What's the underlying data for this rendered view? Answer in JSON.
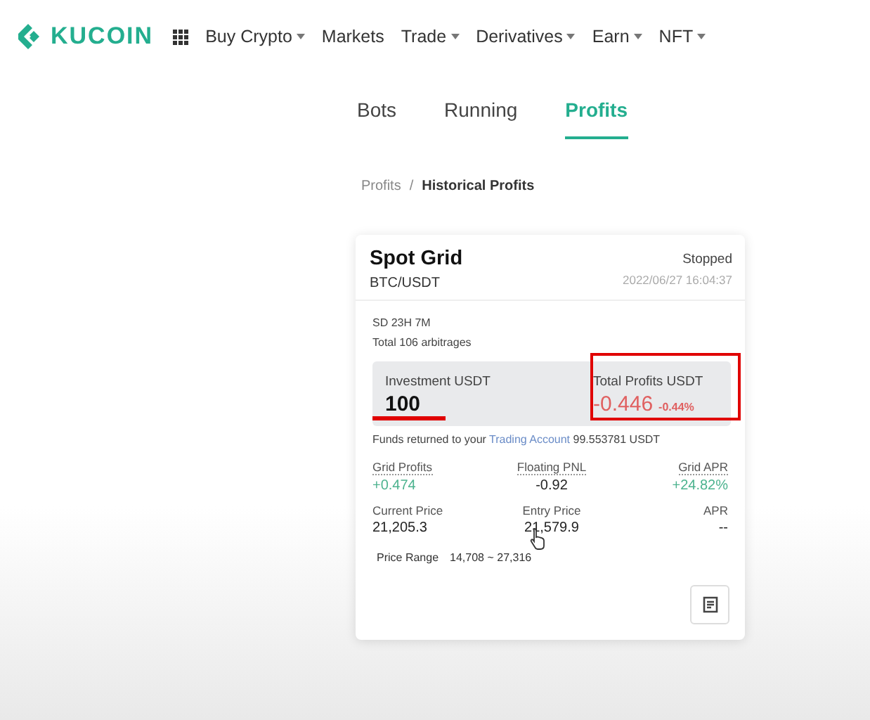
{
  "header": {
    "logo": "KUCOIN",
    "nav": [
      {
        "label": "Buy Crypto",
        "caret": true
      },
      {
        "label": "Markets",
        "caret": false
      },
      {
        "label": "Trade",
        "caret": true
      },
      {
        "label": "Derivatives",
        "caret": true
      },
      {
        "label": "Earn",
        "caret": true
      },
      {
        "label": "NFT",
        "caret": true
      }
    ]
  },
  "tabs": [
    {
      "label": "Bots",
      "selected": false
    },
    {
      "label": "Running",
      "selected": false
    },
    {
      "label": "Profits",
      "selected": true
    }
  ],
  "breadcrumb": {
    "parent": "Profits",
    "separator": "/",
    "current": "Historical Profits"
  },
  "card": {
    "title": "Spot Grid",
    "pair": "BTC/USDT",
    "status": "Stopped",
    "time": "2022/06/27 16:04:37",
    "duration": "SD 23H 7M",
    "arbitrages": "Total 106 arbitrages",
    "investment": {
      "label": "Investment USDT",
      "value": "100"
    },
    "total_profits": {
      "label": "Total Profits USDT",
      "value": "-0.446",
      "percent": "-0.44%"
    },
    "funds": {
      "before": "Funds returned to your",
      "link": "Trading Account",
      "after": "99.553781 USDT"
    },
    "metrics": [
      {
        "label": "Grid Profits",
        "value": "+0.474",
        "color": "#4db38f",
        "dotted": true
      },
      {
        "label": "Floating PNL",
        "value": "-0.92",
        "color": "#222222",
        "dotted": true
      },
      {
        "label": "Grid APR",
        "value": "+24.82%",
        "color": "#4db38f",
        "dotted": true
      },
      {
        "label": "Current Price",
        "value": "21,205.3",
        "color": "#222222",
        "dotted": false
      },
      {
        "label": "Entry Price",
        "value": "21,579.9",
        "color": "#222222",
        "dotted": false
      },
      {
        "label": "APR",
        "value": "--",
        "color": "#222222",
        "dotted": false
      }
    ],
    "price_range": {
      "label": "Price Range",
      "value": "14,708 ~ 27,316"
    }
  }
}
